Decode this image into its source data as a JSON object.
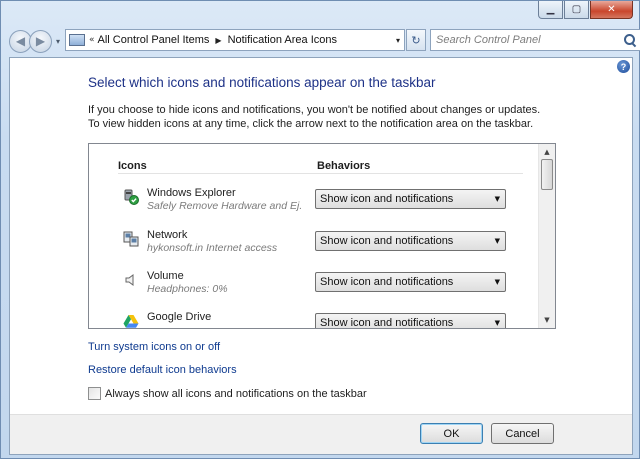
{
  "window": {
    "caption": {
      "minimize": "▁",
      "maximize": "▢",
      "close": "✕"
    }
  },
  "navbar": {
    "back_glyph": "◀",
    "forward_glyph": "▶",
    "history_glyph": "▾",
    "breadcrumb": [
      "All Control Panel Items",
      "Notification Area Icons"
    ],
    "breadcrumb_sep": "«",
    "breadcrumb_arrow": "▶",
    "address_dropdown": "▾",
    "refresh_glyph": "↻",
    "search_placeholder": "Search Control Panel"
  },
  "page": {
    "title": "Select which icons and notifications appear on the taskbar",
    "description": "If you choose to hide icons and notifications, you won't be notified about changes or updates. To view hidden icons at any time, click the arrow next to the notification area on the taskbar.",
    "help_glyph": "?"
  },
  "list": {
    "headers": {
      "icons": "Icons",
      "behaviors": "Behaviors"
    },
    "rows": [
      {
        "name": "Windows Explorer",
        "sub": "Safely Remove Hardware and Ej...",
        "behavior": "Show icon and notifications",
        "icon": "safely-remove-hardware-icon"
      },
      {
        "name": "Network",
        "sub": "hykonsoft.in Internet access",
        "behavior": "Show icon and notifications",
        "icon": "network-icon"
      },
      {
        "name": "Volume",
        "sub": "Headphones: 0%",
        "behavior": "Show icon and notifications",
        "icon": "speaker-icon"
      },
      {
        "name": "Google Drive",
        "sub": "",
        "behavior": "Show icon and notifications",
        "icon": "google-drive-icon"
      }
    ],
    "dropdown_glyph": "▼",
    "scroll_up": "▲",
    "scroll_down": "▼"
  },
  "links": {
    "system_icons": "Turn system icons on or off",
    "restore": "Restore default icon behaviors"
  },
  "checkbox": {
    "label": "Always show all icons and notifications on the taskbar",
    "checked": false
  },
  "buttons": {
    "ok": "OK",
    "cancel": "Cancel"
  }
}
